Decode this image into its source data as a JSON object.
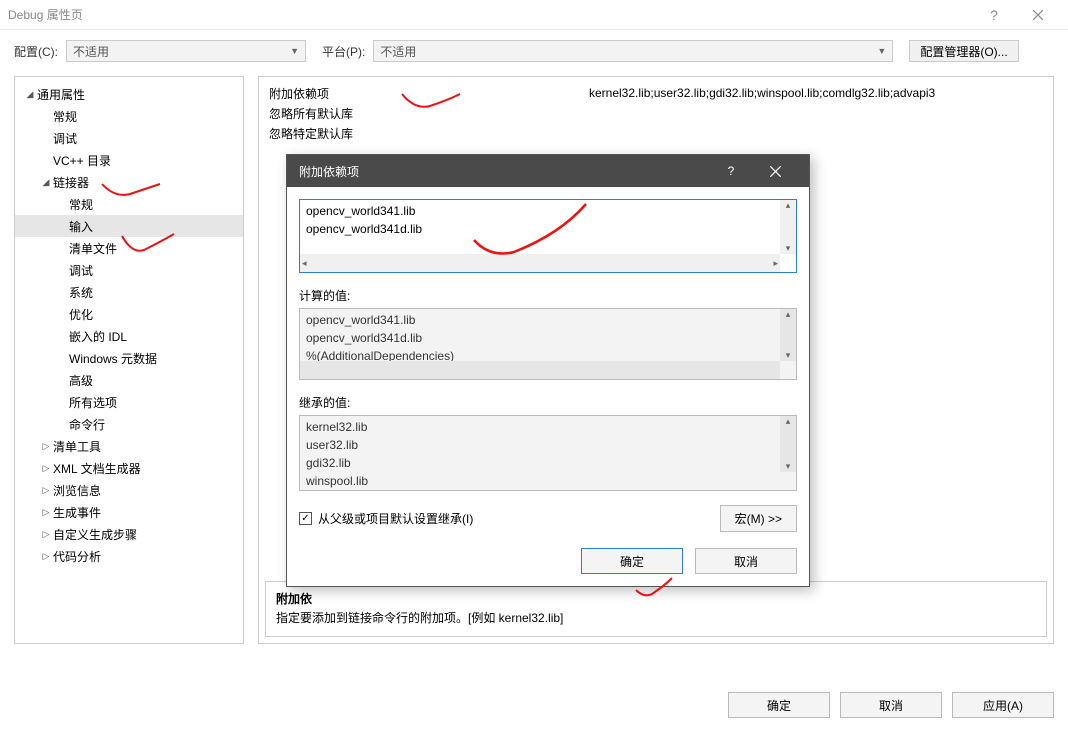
{
  "window": {
    "title": "Debug 属性页"
  },
  "toolbar": {
    "config_label": "配置(C):",
    "config_value": "不适用",
    "platform_label": "平台(P):",
    "platform_value": "不适用",
    "cfgmgr": "配置管理器(O)..."
  },
  "tree": {
    "common": "通用属性",
    "general": "常规",
    "debug": "调试",
    "vcdirs": "VC++ 目录",
    "linker": "链接器",
    "linker_general": "常规",
    "linker_input": "输入",
    "linker_manifest": "清单文件",
    "linker_debug": "调试",
    "linker_system": "系统",
    "linker_optimize": "优化",
    "linker_idl": "嵌入的 IDL",
    "linker_winmeta": "Windows 元数据",
    "linker_advanced": "高级",
    "linker_all": "所有选项",
    "linker_cmdline": "命令行",
    "manifest_tool": "清单工具",
    "xml_doc": "XML 文档生成器",
    "browse": "浏览信息",
    "build_events": "生成事件",
    "custom_build": "自定义生成步骤",
    "code_analysis": "代码分析"
  },
  "grid": {
    "additional_deps_label": "附加依赖项",
    "additional_deps_value": "kernel32.lib;user32.lib;gdi32.lib;winspool.lib;comdlg32.lib;advapi3",
    "ignore_all_label": "忽略所有默认库",
    "ignore_specific_label": "忽略特定默认库"
  },
  "desc": {
    "title": "附加依",
    "text": "指定要添加到链接命令行的附加项。[例如 kernel32.lib]"
  },
  "buttons": {
    "ok": "确定",
    "cancel": "取消",
    "apply": "应用(A)"
  },
  "modal": {
    "title": "附加依赖项",
    "edit_lines": [
      "opencv_world341.lib",
      "opencv_world341d.lib"
    ],
    "computed_label": "计算的值:",
    "computed_lines": [
      "opencv_world341.lib",
      "opencv_world341d.lib",
      "%(AdditionalDependencies)"
    ],
    "inherited_label": "继承的值:",
    "inherited_lines": [
      "kernel32.lib",
      "user32.lib",
      "gdi32.lib",
      "winspool.lib"
    ],
    "inherit_checkbox": "从父级或项目默认设置继承(I)",
    "macro": "宏(M) >>",
    "ok": "确定",
    "cancel": "取消"
  }
}
